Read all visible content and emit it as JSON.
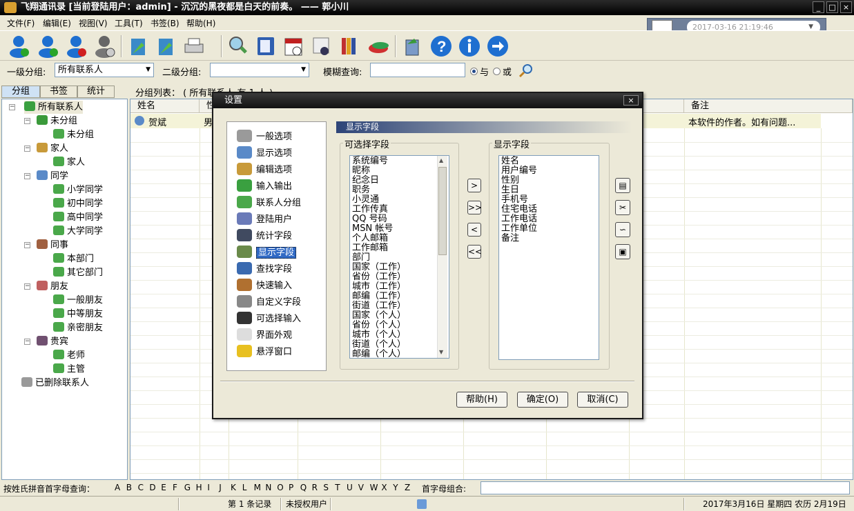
{
  "window": {
    "title": "飞翔通讯录  [当前登陆用户：admin]  -  沉沉的黑夜都是白天的前奏。 —— 郭小川",
    "min": "_",
    "max": "□",
    "close": "×"
  },
  "menu": [
    "文件(F)",
    "编辑(E)",
    "视图(V)",
    "工具(T)",
    "书签(B)",
    "帮助(H)"
  ],
  "clock": {
    "datetime": "2017-03-16 21:19:46"
  },
  "toolbar": {
    "icons": [
      "add-user-icon",
      "edit-user-icon",
      "delete-user-icon",
      "user-search-icon",
      "import-icon",
      "export-icon",
      "print-icon",
      "find-icon",
      "phone-book-icon",
      "calendar-icon",
      "clock-icon",
      "books-icon",
      "tools-icon",
      "recycle-icon",
      "help-icon",
      "info-icon",
      "forward-icon"
    ]
  },
  "filter": {
    "level1_label": "一级分组:",
    "level1_value": "所有联系人",
    "level2_label": "二级分组:",
    "level2_value": "",
    "fuzzy_label": "模糊查询:",
    "fuzzy_value": "",
    "and_label": "与",
    "or_label": "或"
  },
  "tabs": [
    "分组",
    "书签",
    "统计"
  ],
  "tree": {
    "root": "所有联系人",
    "nodes": [
      {
        "label": "未分组",
        "children": [
          "未分组"
        ]
      },
      {
        "label": "家人",
        "children": [
          "家人"
        ]
      },
      {
        "label": "同学",
        "children": [
          "小学同学",
          "初中同学",
          "高中同学",
          "大学同学"
        ]
      },
      {
        "label": "同事",
        "children": [
          "本部门",
          "其它部门"
        ]
      },
      {
        "label": "朋友",
        "children": [
          "一般朋友",
          "中等朋友",
          "亲密朋友"
        ]
      },
      {
        "label": "贵宾",
        "children": [
          "老师",
          "主管"
        ]
      }
    ],
    "deleted": "已删除联系人"
  },
  "grid": {
    "list_label": "分组列表：   ( 所有联系人 有 1 人 )",
    "columns": [
      "姓名",
      "性",
      "备注"
    ],
    "rows": [
      {
        "name": "贺斌",
        "gender": "男",
        "note": "本软件的作者。如有问题..."
      }
    ]
  },
  "alphabar": {
    "label": "按姓氏拼音首字母查询：",
    "letters": [
      "A",
      "B",
      "C",
      "D",
      "E",
      "F",
      "G",
      "H",
      "I",
      "J",
      "K",
      "L",
      "M",
      "N",
      "O",
      "P",
      "Q",
      "R",
      "S",
      "T",
      "U",
      "V",
      "W",
      "X",
      "Y",
      "Z"
    ],
    "combo_label": "首字母组合:",
    "combo_value": ""
  },
  "status": {
    "records": "第 1 条记录",
    "license": "未授权用户",
    "date": "2017年3月16日 星期四 农历 2月19日"
  },
  "dialog": {
    "title": "设置",
    "close": "×",
    "nav": [
      "一般选项",
      "显示选项",
      "编辑选项",
      "输入输出",
      "联系人分组",
      "登陆用户",
      "统计字段",
      "显示字段",
      "查找字段",
      "快速输入",
      "自定义字段",
      "可选择输入",
      "界面外观",
      "悬浮窗口"
    ],
    "selected_nav": "显示字段",
    "section": "显示字段",
    "available_label": "可选择字段",
    "available": [
      "系统编号",
      "昵称",
      "纪念日",
      "职务",
      "小灵通",
      "工作传真",
      "QQ 号码",
      "MSN 帐号",
      "个人邮箱",
      "工作邮箱",
      "部门",
      "国家（工作）",
      "省份（工作）",
      "城市（工作）",
      "邮编（工作）",
      "街道（工作）",
      "国家（个人）",
      "省份（个人）",
      "城市（个人）",
      "街道（个人）",
      "邮编（个人）"
    ],
    "shown_label": "显示字段",
    "shown": [
      "姓名",
      "用户编号",
      "性别",
      "生日",
      "手机号",
      "住宅电话",
      "工作电话",
      "工作单位",
      "备注"
    ],
    "move": [
      ">",
      ">>",
      "<",
      "<<"
    ],
    "side_icons": [
      "properties-icon",
      "cut-icon",
      "signature-icon",
      "package-icon"
    ],
    "buttons": {
      "help": "帮助(H)",
      "ok": "确定(O)",
      "cancel": "取消(C)"
    }
  }
}
